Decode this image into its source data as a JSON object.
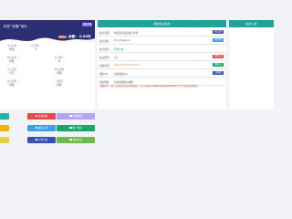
{
  "left": {
    "site_name": "虹货广告推广助手 -",
    "upgrade_label": "我要升级",
    "vip_badge": "普通会员",
    "balance_label": "余额：",
    "balance_value": "0.00元",
    "stats": [
      {
        "label": "今日充值",
        "value": "0元"
      },
      {
        "label": "今日推广",
        "value": "1"
      },
      {
        "label": "昨日充值",
        "value": "0元"
      },
      {
        "label": "总计推广",
        "value": "0"
      },
      {
        "label": "今日返利",
        "value": "0元"
      },
      {
        "label": "昨日返利",
        "value": "0元"
      },
      {
        "label": "总计返利",
        "value": "0元"
      },
      {
        "label": "可提现",
        "value": "0元"
      }
    ]
  },
  "shortcuts": [
    {
      "label": "",
      "color": "#1fb3a9"
    },
    {
      "label": "在线充值",
      "color": "#e8474a"
    },
    {
      "label": "在线提现",
      "color": "#b1a3f5"
    },
    {
      "label": "",
      "color": "#f4b300"
    },
    {
      "label": "我的工单",
      "color": "#3aa0e8"
    },
    {
      "label": "推广链接",
      "color": "#1aa867"
    },
    {
      "label": "",
      "color": "#e0d243"
    },
    {
      "label": "订单记录",
      "color": "#3a4fb6"
    },
    {
      "label": "返利记录",
      "color": "#6fb94f"
    }
  ],
  "middle": {
    "title": "我的站点信息",
    "rows": [
      {
        "key": "站点名称：",
        "value": "你还没有设定站点名称",
        "btn": "修改设置",
        "btn_color": "#3a4fb6",
        "value_class": ""
      },
      {
        "key": "站点域名：",
        "value": "211.ylrgws.cn",
        "btn": "修改域名",
        "btn_color": "#3aa0e8",
        "value_class": ""
      },
      {
        "key": "站点类型：",
        "value": "普通分站",
        "btn": "",
        "btn_color": "",
        "value_class": "green"
      },
      {
        "key": "站点费用：",
        "value": "0元",
        "btn": "续费站点",
        "btn_color": "#e8474a",
        "value_class": ""
      },
      {
        "key": "到期时间：",
        "value": "2024-07-08 00:00:00",
        "btn": "续期站点",
        "btn_color": "#1aa867",
        "value_class": "orange"
      },
      {
        "key": "绑定QQ：",
        "value": "还未绑定QQ",
        "btn": "立即绑定",
        "btn_color": "#3a4fb6",
        "value_class": ""
      },
      {
        "key": "绑定微信：",
        "value": "还未绑定微信提醒",
        "btn": "",
        "btn_color": "",
        "value_class": ""
      }
    ],
    "notice": "温馨提示：推广后返利收益自动到账后，可以直接在余额中提现或者用于购买平台上的商品和服务。"
  },
  "right": {
    "title": "站点公告"
  }
}
